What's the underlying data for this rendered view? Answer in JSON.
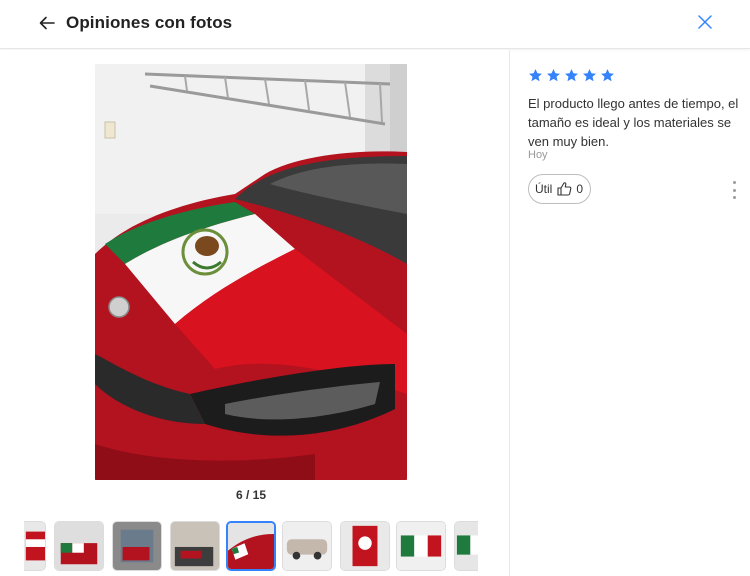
{
  "header": {
    "title": "Opiniones con fotos",
    "back_icon": "arrow-left-icon",
    "close_icon": "close-icon",
    "accent_color": "#3483fa"
  },
  "gallery": {
    "current": 6,
    "total": 15,
    "counter_text": "6 / 15",
    "active_thumbnail": 5,
    "thumbnails": [
      {
        "icon": "car-flag-thumb-icon"
      },
      {
        "icon": "car-flag-thumb-icon"
      },
      {
        "icon": "car-front-thumb-icon"
      },
      {
        "icon": "car-garage-thumb-icon"
      },
      {
        "icon": "car-flag-thumb-icon"
      },
      {
        "icon": "car-side-thumb-icon"
      },
      {
        "icon": "flag-hood-thumb-icon"
      },
      {
        "icon": "flag-hood-thumb-icon"
      },
      {
        "icon": "car-flag-thumb-icon"
      }
    ]
  },
  "review": {
    "rating": 5,
    "rating_max": 5,
    "star_color": "#3483fa",
    "text": "El producto llego antes de tiempo, el tamaño es ideal y los materiales se ven muy bien.",
    "date": "Hoy",
    "useful_label": "Útil",
    "useful_count": "0",
    "more_icon": "more-vertical-icon"
  }
}
